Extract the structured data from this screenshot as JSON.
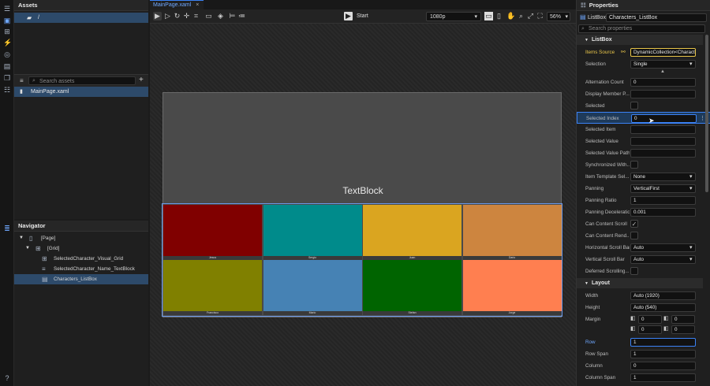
{
  "assets_panel": {
    "title": "Assets",
    "root_folder": "/",
    "search_placeholder": "Search assets",
    "file": "MainPage.xaml"
  },
  "navigator": {
    "title": "Navigator",
    "items": [
      {
        "label": "[Page]",
        "indent": 0
      },
      {
        "label": "[Grid]",
        "indent": 1
      },
      {
        "label": "SelectedCharacter_Visual_Grid",
        "indent": 2
      },
      {
        "label": "SelectedCharacter_Name_TextBlock",
        "indent": 2
      },
      {
        "label": "Characters_ListBox",
        "indent": 2,
        "selected": true
      }
    ]
  },
  "editor": {
    "tab": "MainPage.xaml",
    "start_label": "Start",
    "resolution": "1080p",
    "zoom": "56%",
    "canvas_text": "TextBlock",
    "characters": [
      {
        "name": "Jesus",
        "color": "#800000"
      },
      {
        "name": "Sergio",
        "color": "#008b8b"
      },
      {
        "name": "Juan",
        "color": "#daa520"
      },
      {
        "name": "Dario",
        "color": "#cd853f"
      },
      {
        "name": "Francisco",
        "color": "#808000"
      },
      {
        "name": "Mario",
        "color": "#4682b4"
      },
      {
        "name": "Stefan",
        "color": "#006400"
      },
      {
        "name": "Jorge",
        "color": "#ff7f50"
      }
    ]
  },
  "properties": {
    "title": "Properties",
    "type": "ListBox",
    "name": "Characters_ListBox",
    "search_placeholder": "Search properties",
    "listbox_section": "ListBox",
    "listbox_rows": [
      {
        "label": "Items Source",
        "value": "DynamicCollection<Characte",
        "kind": "source"
      },
      {
        "label": "Selection",
        "value": "Single",
        "kind": "dropdown"
      },
      {
        "label": "Alternation Count",
        "value": "0",
        "kind": "text"
      },
      {
        "label": "Display Member P...",
        "value": "",
        "kind": "text"
      },
      {
        "label": "Selected",
        "value": "",
        "kind": "check"
      },
      {
        "label": "Selected Index",
        "value": "0",
        "kind": "text",
        "selected": true
      },
      {
        "label": "Selected Item",
        "value": "",
        "kind": "text"
      },
      {
        "label": "Selected Value",
        "value": "",
        "kind": "text"
      },
      {
        "label": "Selected Value Path",
        "value": "",
        "kind": "text"
      },
      {
        "label": "Synchronized With...",
        "value": "",
        "kind": "check"
      },
      {
        "label": "Item Template Sel...",
        "value": "None",
        "kind": "dropdown"
      },
      {
        "label": "Panning",
        "value": "VerticalFirst",
        "kind": "dropdown"
      },
      {
        "label": "Panning Ratio",
        "value": "1",
        "kind": "text"
      },
      {
        "label": "Panning Deceleratio...",
        "value": "0.001",
        "kind": "text"
      },
      {
        "label": "Can Content Scroll",
        "value": "✓",
        "kind": "check"
      },
      {
        "label": "Can Content Rend...",
        "value": "",
        "kind": "check"
      },
      {
        "label": "Horizontal Scroll Bar",
        "value": "Auto",
        "kind": "dropdown"
      },
      {
        "label": "Vertical Scroll Bar",
        "value": "Auto",
        "kind": "dropdown"
      },
      {
        "label": "Deferred Scrolling...",
        "value": "",
        "kind": "check"
      }
    ],
    "layout_section": "Layout",
    "layout_rows": [
      {
        "label": "Width",
        "value": "Auto (1920)",
        "kind": "text"
      },
      {
        "label": "Height",
        "value": "Auto (540)",
        "kind": "text"
      },
      {
        "label": "Margin",
        "value": "",
        "kind": "margin",
        "margins": [
          "0",
          "0",
          "0",
          "0"
        ]
      },
      {
        "label": "Row",
        "value": "1",
        "kind": "text",
        "highlight": true
      },
      {
        "label": "Row Span",
        "value": "1",
        "kind": "text"
      },
      {
        "label": "Column",
        "value": "0",
        "kind": "text"
      },
      {
        "label": "Column Span",
        "value": "1",
        "kind": "text"
      }
    ]
  }
}
